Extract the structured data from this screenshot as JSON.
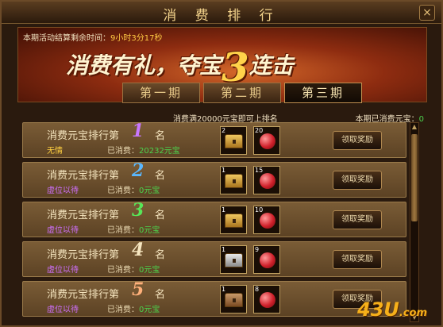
{
  "window": {
    "title": "消 费 排 行",
    "close_glyph": "×"
  },
  "banner": {
    "countdown_label": "本期活动结算剩余时间：",
    "countdown_value": "9小时3分17秒",
    "slogan_part1": "消费有礼，夺宝",
    "slogan_number": "3",
    "slogan_part2": "连击"
  },
  "tabs": [
    {
      "label": "第一期",
      "active": false
    },
    {
      "label": "第二期",
      "active": false
    },
    {
      "label": "第三期",
      "active": true
    }
  ],
  "info": {
    "rank_rule": "消费满20000元宝即可上排名",
    "my_spent_label": "本期已消费元宝：",
    "my_spent_value": "0"
  },
  "rank_label": "消费元宝排行第",
  "ming": "名",
  "spent_label": "已消费：",
  "claim_label": "领取奖励",
  "colors": {
    "rank_1": "#c878ff",
    "rank_2": "#5ab8ff",
    "rank_3": "#58e658",
    "rank_4": "#f6e6c0",
    "rank_5": "#ffb07a",
    "player_named": "#ffd040",
    "player_empty": "#d070ff"
  },
  "rows": [
    {
      "rank": "1",
      "player": "无情",
      "spent": "20232元宝",
      "chest": {
        "type": "gold",
        "count": "2"
      },
      "gem_count": "20"
    },
    {
      "rank": "2",
      "player": "虚位以待",
      "spent": "0元宝",
      "chest": {
        "type": "gold",
        "count": "1"
      },
      "gem_count": "15"
    },
    {
      "rank": "3",
      "player": "虚位以待",
      "spent": "0元宝",
      "chest": {
        "type": "gold",
        "count": "1"
      },
      "gem_count": "10"
    },
    {
      "rank": "4",
      "player": "虚位以待",
      "spent": "0元宝",
      "chest": {
        "type": "silver",
        "count": "1"
      },
      "gem_count": "9"
    },
    {
      "rank": "5",
      "player": "虚位以待",
      "spent": "0元宝",
      "chest": {
        "type": "bronze",
        "count": "1"
      },
      "gem_count": "8"
    }
  ],
  "watermark": {
    "text": "43U",
    "suffix": ".com"
  }
}
